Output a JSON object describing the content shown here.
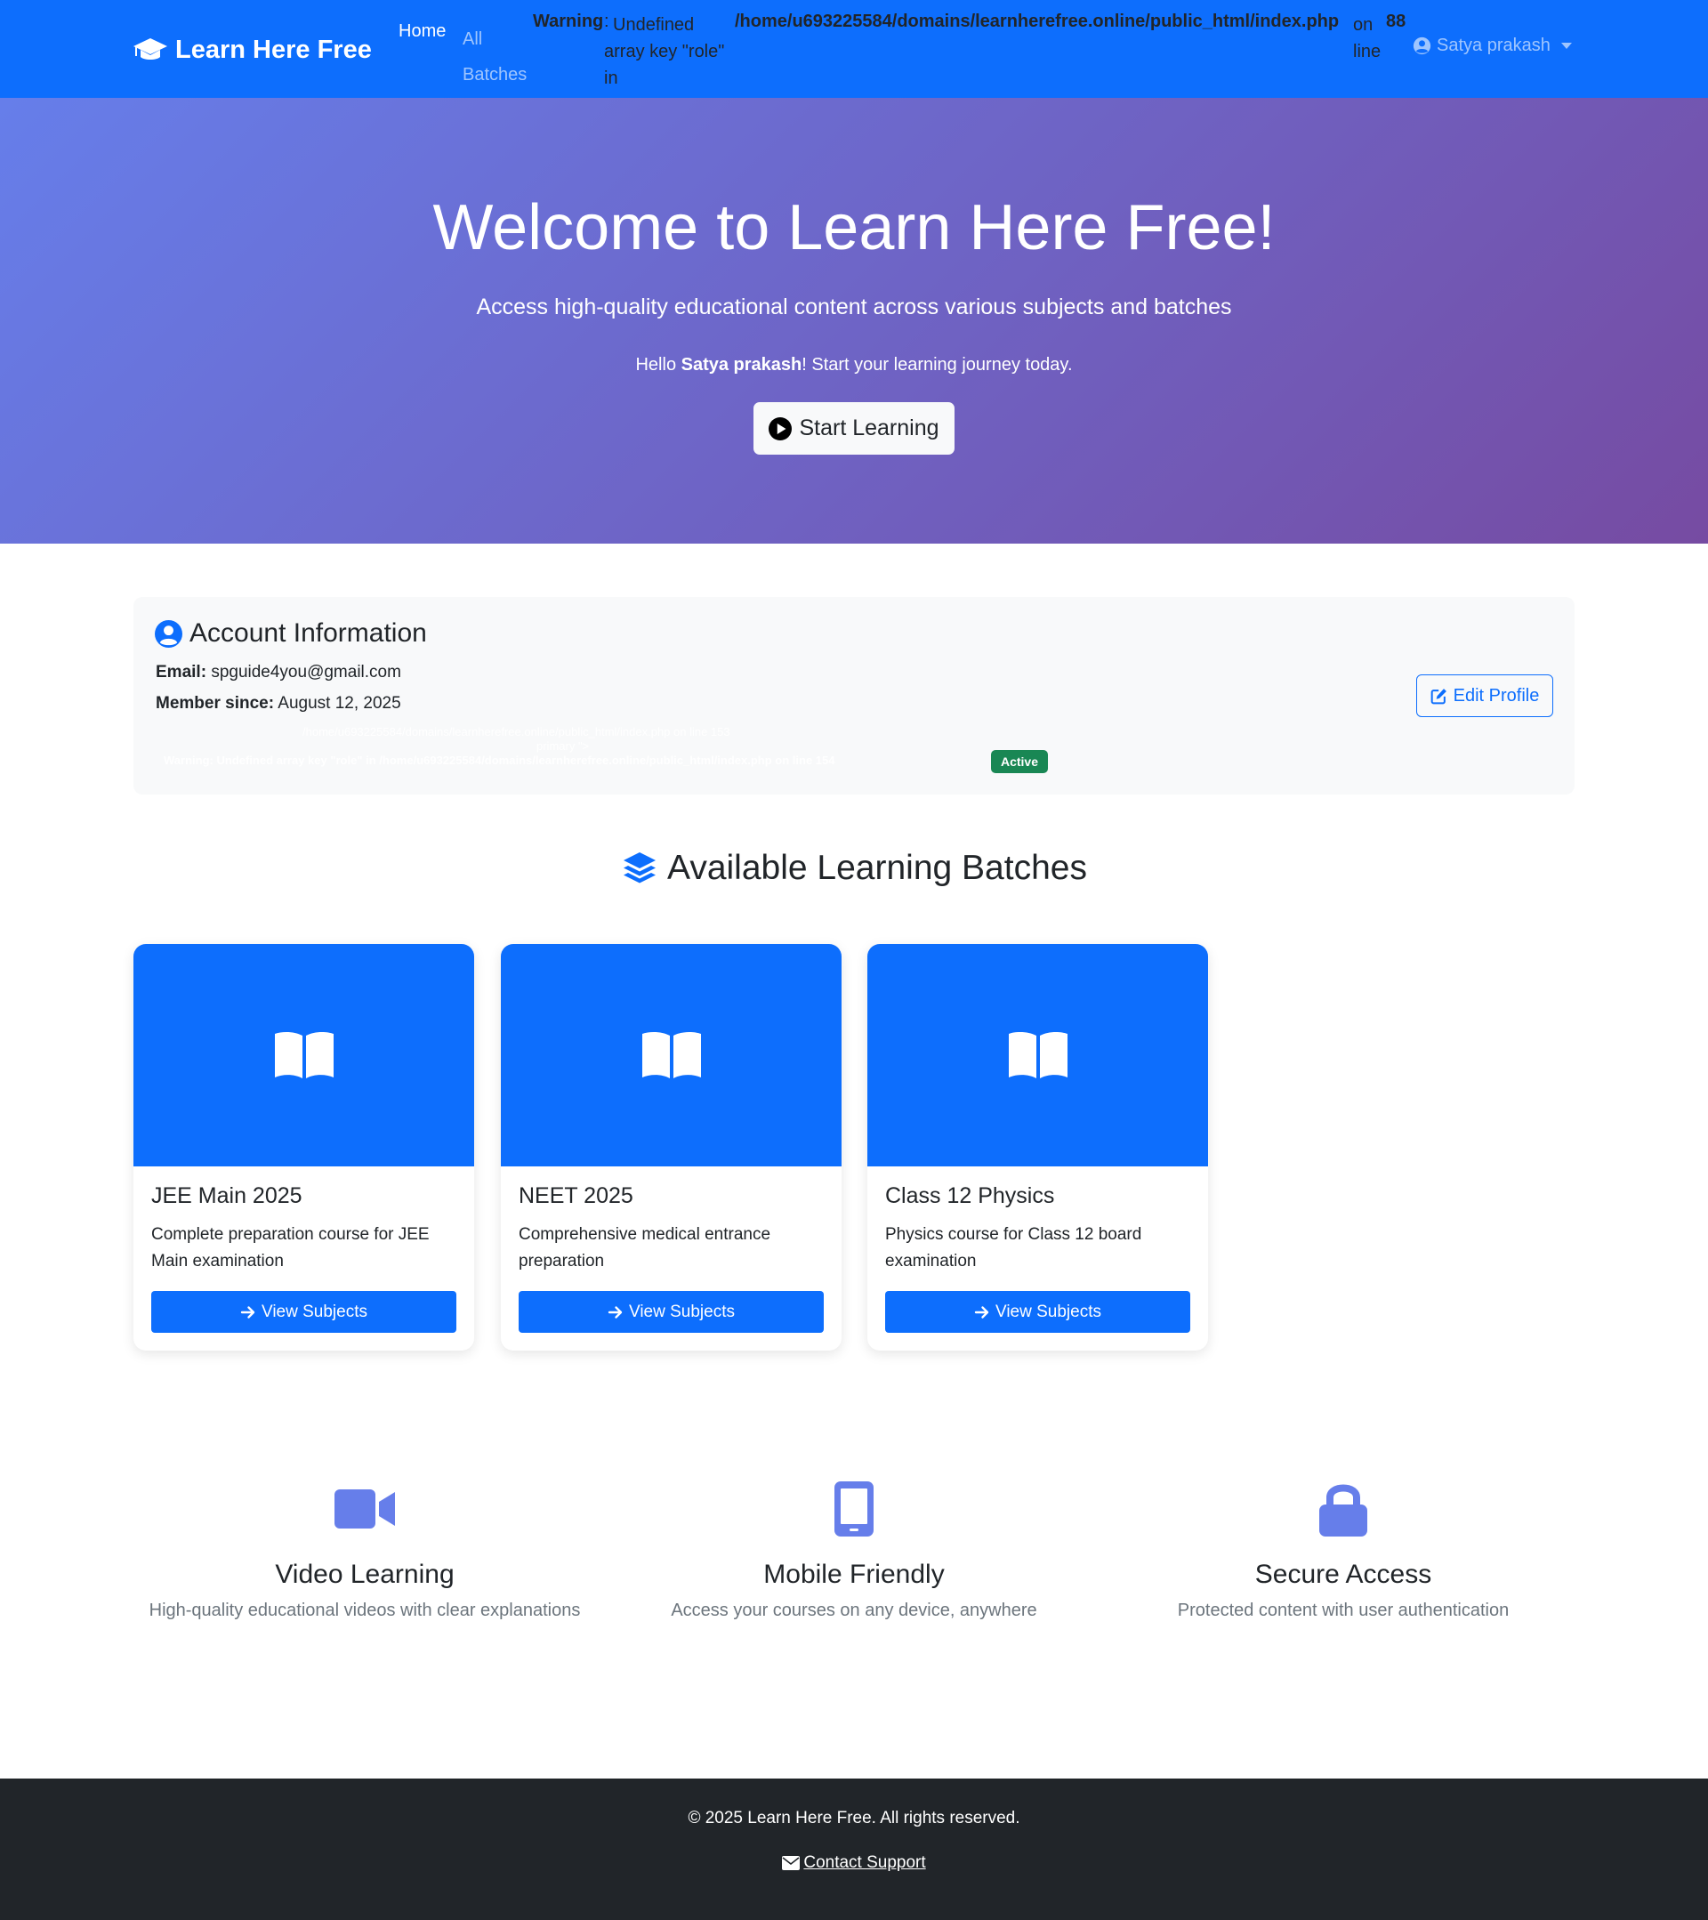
{
  "navbar": {
    "brand": "Learn Here Free",
    "home": "Home",
    "all_batches": "All Batches",
    "warning_label": "Warning",
    "warning_colon": ":",
    "warning_text": "Undefined array key \"role\" in",
    "warning_path": "/home/u693225584/domains/learnherefree.online/public_html/index.php",
    "warning_on_line": "on line",
    "warning_line_number": "88",
    "user_name": "Satya prakash",
    "bg_color": "#0d6efd"
  },
  "hero": {
    "title": "Welcome to Learn Here Free!",
    "lead": "Access high-quality educational content across various subjects and batches",
    "hello_prefix": "Hello ",
    "hello_name": "Satya prakash",
    "hello_suffix": "! Start your learning journey today.",
    "button": "Start Learning"
  },
  "account": {
    "title": "Account Information",
    "email_label": "Email:",
    "email_value": "spguide4you@gmail.com",
    "since_label": "Member since:",
    "since_value": "August 12, 2025",
    "hidden_warning_1": "/home/u693225584/domains/learnherefree.online/public_html/index.php on line 153",
    "hidden_warning_2": "primary \">",
    "hidden_warning_3": "Warning: Undefined array key \"role\" in /home/u693225584/domains/learnherefree.online/public_html/index.php on line 154",
    "badge": "Active",
    "edit_button": "Edit Profile"
  },
  "batches": {
    "title": "Available Learning Batches",
    "items": [
      {
        "title": "JEE Main 2025",
        "description": "Complete preparation course for JEE Main examination",
        "button": "View Subjects"
      },
      {
        "title": "NEET 2025",
        "description": "Comprehensive medical entrance preparation",
        "button": "View Subjects"
      },
      {
        "title": "Class 12 Physics",
        "description": "Physics course for Class 12 board examination",
        "button": "View Subjects"
      }
    ]
  },
  "features": [
    {
      "icon": "video-icon",
      "title": "Video Learning",
      "description": "High-quality educational videos with clear explanations"
    },
    {
      "icon": "mobile-icon",
      "title": "Mobile Friendly",
      "description": "Access your courses on any device, anywhere"
    },
    {
      "icon": "lock-icon",
      "title": "Secure Access",
      "description": "Protected content with user authentication"
    }
  ],
  "footer": {
    "copyright": "© 2025 Learn Here Free. All rights reserved.",
    "contact": "Contact Support"
  },
  "colors": {
    "primary": "#0d6efd",
    "hero_gradient_start": "#667eea",
    "hero_gradient_end": "#764ba2",
    "feature_icon": "#667eea",
    "success": "#198754",
    "footer_bg": "#212529"
  }
}
